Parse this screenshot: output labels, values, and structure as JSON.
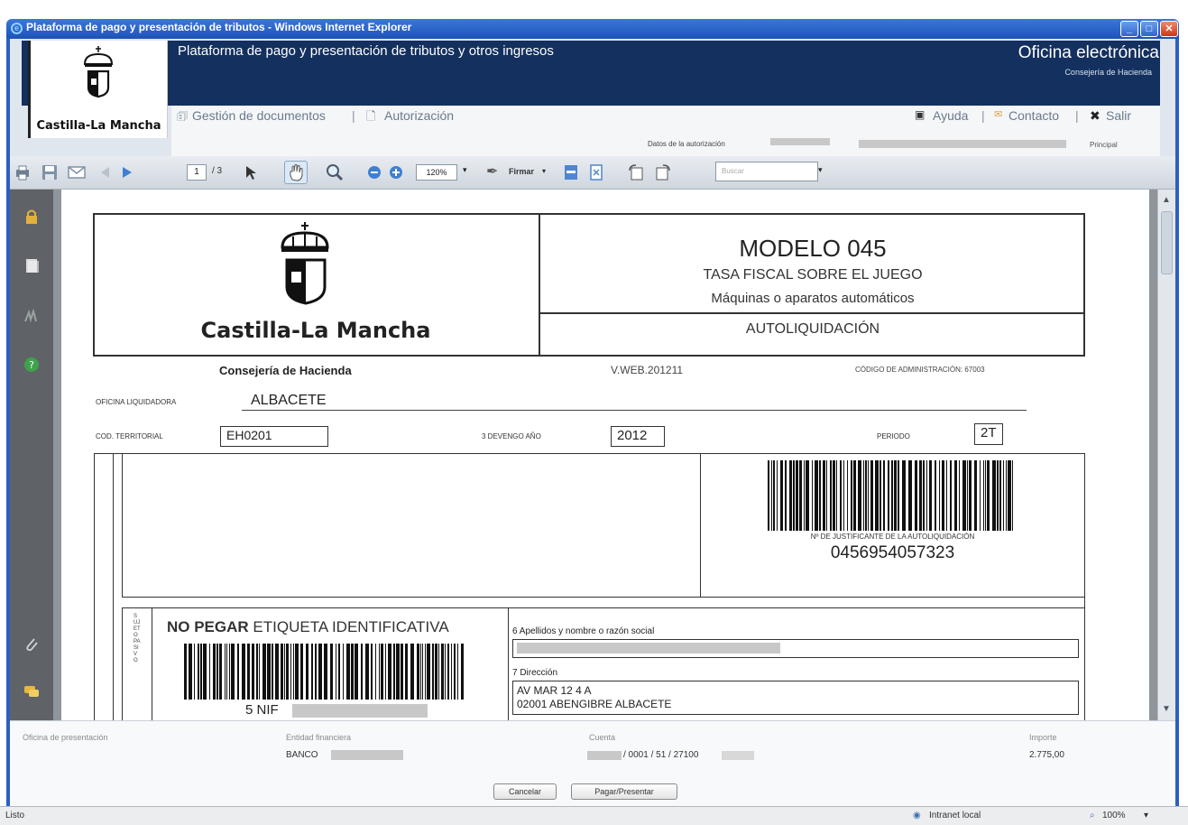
{
  "window": {
    "title": "Plataforma de pago y presentación de tributos - Windows Internet Explorer"
  },
  "header": {
    "logo_caption": "Castilla-La Mancha",
    "platform_title": "Plataforma de pago y presentación de tributos y otros ingresos",
    "office_title": "Oficina electrónica",
    "office_subtitle": "Consejería de Hacienda"
  },
  "nav": {
    "documents": "Gestión de documentos",
    "authorization": "Autorización",
    "help": "Ayuda",
    "contact": "Contacto",
    "exit": "Salir",
    "auth_data_label": "Datos de la autorización",
    "principal": "Principal"
  },
  "toolbar": {
    "page_current": "1",
    "page_total": "/ 3",
    "zoom": "120%",
    "sign_label": "Firmar",
    "search_placeholder": "Buscar"
  },
  "doc": {
    "logo_caption": "Castilla-La Mancha",
    "model_title": "MODELO 045",
    "model_subtitle": "TASA FISCAL SOBRE EL JUEGO",
    "model_subsubtitle": "Máquinas o aparatos automáticos",
    "self_assessment": "AUTOLIQUIDACIÓN",
    "consejeria": "Consejería de Hacienda",
    "version": "V.WEB.201211",
    "admin_code": "CÓDIGO DE ADMINISTRACIÓN: 67003",
    "office_label": "OFICINA LIQUIDADORA",
    "office_value": "ALBACETE",
    "territorial_label": "COD. TERRITORIAL",
    "territorial_value": "EH0201",
    "accrual_label": "3 DEVENGO AÑO",
    "accrual_value": "2012",
    "period_label": "PERIODO",
    "period_value": "2T",
    "justificante_label": "Nº DE JUSTIFICANTE DE LA AUTOLIQUIDACIÓN",
    "justificante_value": "0456954057323",
    "no_pegar_bold": "NO PEGAR",
    "no_pegar_rest": "ETIQUETA IDENTIFICATIVA",
    "nif_label": "5 NIF",
    "sujeto_pasivo": "SUJETO PASIVO",
    "name_label": "6 Apellidos y nombre o razón social",
    "address_label": "7 Dirección",
    "address_line1": "AV MAR 12   4 A",
    "address_line2": "02001 ABENGIBRE ALBACETE"
  },
  "bottom": {
    "office_label": "Oficina de presentación",
    "entity_label": "Entidad financiera",
    "entity_value": "BANCO",
    "account_label": "Cuenta",
    "account_value": "/ 0001 / 51 / 27100",
    "amount_label": "Importe",
    "amount_value": "2.775,00",
    "cancel_label": "Cancelar",
    "pay_label": "Pagar/Presentar"
  },
  "status": {
    "left": "Listo",
    "zone": "Intranet local",
    "zoom": "100%"
  },
  "colors": {
    "navy": "#13305f",
    "title_bar": "#2b63c9"
  }
}
